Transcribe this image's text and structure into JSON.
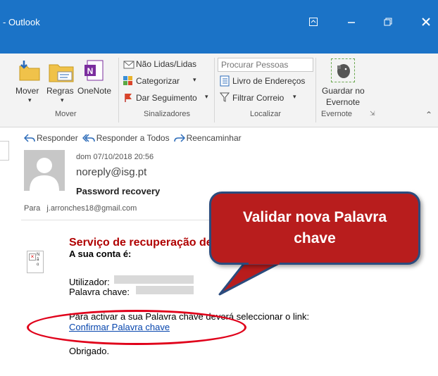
{
  "window": {
    "title": "- Outlook"
  },
  "ribbon": {
    "move_group": {
      "move_label": "Mover",
      "rules_label": "Regras",
      "onenote_label": "OneNote",
      "group_label": "Mover"
    },
    "tags_group": {
      "unread_label": "Não Lidas/Lidas",
      "categorize_label": "Categorizar",
      "followup_label": "Dar Seguimento",
      "group_label": "Sinalizadores"
    },
    "find_group": {
      "search_placeholder": "Procurar Pessoas",
      "address_book_label": "Livro de Endereços",
      "filter_label": "Filtrar Correio",
      "group_label": "Localizar"
    },
    "evernote_group": {
      "save_label_1": "Guardar no",
      "save_label_2": "Evernote",
      "group_label": "Evernote"
    }
  },
  "message": {
    "actions": {
      "reply": "Responder",
      "reply_all": "Responder a Todos",
      "forward": "Reencaminhar"
    },
    "date": "dom 07/10/2018 20:56",
    "sender": "noreply@isg.pt",
    "subject": "Password recovery",
    "to_label": "Para",
    "to_address": "j.arronches18@gmail.com",
    "body": {
      "heading": "Serviço de recuperação de palavra chave",
      "account_line": "A sua conta é:",
      "user_label": "Utilizador:",
      "password_label": "Palavra chave:",
      "activate_text": "Para activar a sua Palavra chave deverá seleccionar o link:",
      "link_text": "Confirmar Palavra chave",
      "thanks": "Obrigado."
    }
  },
  "callout": {
    "text": "Validar nova Palavra chave"
  },
  "colors": {
    "titlebar": "#1b73c7",
    "callout_fill": "#b81d1d",
    "callout_border": "#2b4c7e",
    "heading": "#b00000",
    "ellipse": "#e0001a"
  }
}
